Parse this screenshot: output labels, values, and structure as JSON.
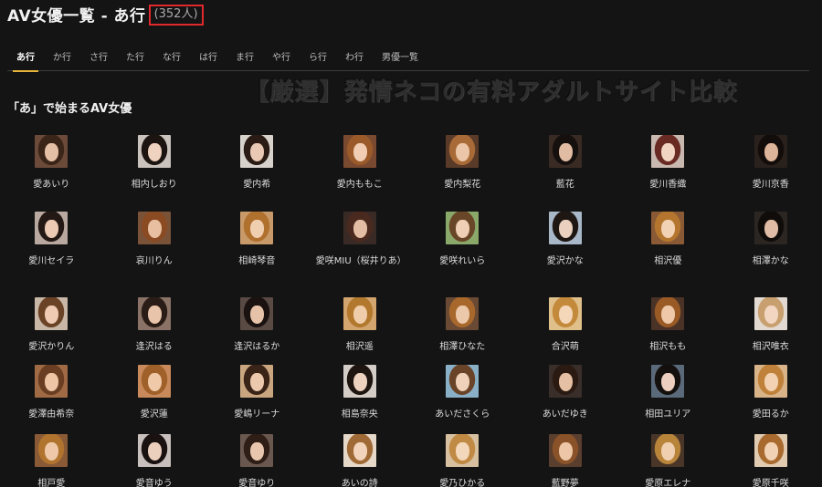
{
  "header": {
    "title": "AV女優一覧 - あ行",
    "count": "(352人)"
  },
  "tabs": [
    {
      "label": "あ行",
      "active": true
    },
    {
      "label": "か行",
      "active": false
    },
    {
      "label": "さ行",
      "active": false
    },
    {
      "label": "た行",
      "active": false
    },
    {
      "label": "な行",
      "active": false
    },
    {
      "label": "は行",
      "active": false
    },
    {
      "label": "ま行",
      "active": false
    },
    {
      "label": "や行",
      "active": false
    },
    {
      "label": "ら行",
      "active": false
    },
    {
      "label": "わ行",
      "active": false
    },
    {
      "label": "男優一覧",
      "active": false
    }
  ],
  "watermark": "【厳選】発情ネコの有料アダルトサイト比較",
  "section_title": "「あ」で始まるAV女優",
  "actresses": [
    {
      "name": "愛あいり",
      "hair": "#3a2518",
      "bg": "#6b4a3a",
      "skin": "#e6c0a6"
    },
    {
      "name": "相内しおり",
      "hair": "#1c1410",
      "bg": "#c9c2bd",
      "skin": "#efd2c0"
    },
    {
      "name": "愛内希",
      "hair": "#2a1c14",
      "bg": "#d8d2cc",
      "skin": "#e9c8b4"
    },
    {
      "name": "愛内ももこ",
      "hair": "#9a5a2a",
      "bg": "#7a4a30",
      "skin": "#f0cdb3"
    },
    {
      "name": "愛内梨花",
      "hair": "#a86a36",
      "bg": "#5a3a28",
      "skin": "#ecc6a8"
    },
    {
      "name": "藍花",
      "hair": "#15100e",
      "bg": "#3a2a24",
      "skin": "#e2bca2"
    },
    {
      "name": "愛川香織",
      "hair": "#6a2a24",
      "bg": "#c8b8b0",
      "skin": "#f2d4c2"
    },
    {
      "name": "愛川京香",
      "hair": "#120c0a",
      "bg": "#2a201c",
      "skin": "#dcb49a"
    },
    {
      "name": "愛川セイラ",
      "hair": "#241814",
      "bg": "#b8a8a0",
      "skin": "#eccab4"
    },
    {
      "name": "哀川りん",
      "hair": "#8a4a22",
      "bg": "#7a5238",
      "skin": "#e8bfa0"
    },
    {
      "name": "相崎琴音",
      "hair": "#b0702e",
      "bg": "#c89a6a",
      "skin": "#f0cfb0"
    },
    {
      "name": "愛咲MIU（桜井りあ）",
      "hair": "#4a2a1e",
      "bg": "#3a2a26",
      "skin": "#e4bea4"
    },
    {
      "name": "愛咲れいら",
      "hair": "#6a4628",
      "bg": "#8aa86a",
      "skin": "#efd0b6"
    },
    {
      "name": "愛沢かな",
      "hair": "#1e1612",
      "bg": "#a8b8c8",
      "skin": "#ead0be"
    },
    {
      "name": "相沢優",
      "hair": "#b4762e",
      "bg": "#8a5a36",
      "skin": "#f2d2b4"
    },
    {
      "name": "相澤かな",
      "hair": "#100c0a",
      "bg": "#2c2622",
      "skin": "#e0bca6"
    },
    {
      "name": "愛沢かりん",
      "hair": "#6a4226",
      "bg": "#c8b6a6",
      "skin": "#eecbb2"
    },
    {
      "name": "逢沢はる",
      "hair": "#2a1c16",
      "bg": "#8a7266",
      "skin": "#e8c4aa"
    },
    {
      "name": "逢沢はるか",
      "hair": "#1a1210",
      "bg": "#5a4a44",
      "skin": "#e6c2a8"
    },
    {
      "name": "相沢遥",
      "hair": "#b2782e",
      "bg": "#d2a46e",
      "skin": "#f0cdaa"
    },
    {
      "name": "相澤ひなた",
      "hair": "#a8682c",
      "bg": "#6a4a34",
      "skin": "#ecc8aa"
    },
    {
      "name": "合沢萌",
      "hair": "#c48a3c",
      "bg": "#e0c08a",
      "skin": "#f4d6b8"
    },
    {
      "name": "相沢もも",
      "hair": "#9a5a26",
      "bg": "#4a3226",
      "skin": "#eec8a8"
    },
    {
      "name": "相沢唯衣",
      "hair": "#c8a070",
      "bg": "#e2dad2",
      "skin": "#f2d6c2"
    },
    {
      "name": "愛澤由希奈",
      "hair": "#6a3e22",
      "bg": "#a06a44",
      "skin": "#eec6a6"
    },
    {
      "name": "愛沢蓮",
      "hair": "#a0602a",
      "bg": "#c88a5a",
      "skin": "#f0caa8"
    },
    {
      "name": "愛嶋リーナ",
      "hair": "#3a2418",
      "bg": "#caa680",
      "skin": "#ecc8ac"
    },
    {
      "name": "相島奈央",
      "hair": "#1e1410",
      "bg": "#d4ccc6",
      "skin": "#eed2c0"
    },
    {
      "name": "あいださくら",
      "hair": "#6a4428",
      "bg": "#8ab0c8",
      "skin": "#f0d2ba"
    },
    {
      "name": "あいだゆき",
      "hair": "#2a1a12",
      "bg": "#3a2e2a",
      "skin": "#e6c0a4"
    },
    {
      "name": "相田ユリア",
      "hair": "#14100e",
      "bg": "#5a6a7a",
      "skin": "#eccfbe"
    },
    {
      "name": "愛田るか",
      "hair": "#c0823a",
      "bg": "#d8b488",
      "skin": "#f2d2b2"
    },
    {
      "name": "相戸愛",
      "hair": "#b0742e",
      "bg": "#8a5a36",
      "skin": "#eec8a8"
    },
    {
      "name": "愛音ゆう",
      "hair": "#1a1210",
      "bg": "#c8c0bc",
      "skin": "#ecd0be"
    },
    {
      "name": "愛音ゆり",
      "hair": "#2e1e16",
      "bg": "#6a584e",
      "skin": "#e8c6ae"
    },
    {
      "name": "あいの詩",
      "hair": "#a06a36",
      "bg": "#e6d8c8",
      "skin": "#f2d4bc"
    },
    {
      "name": "愛乃ひかる",
      "hair": "#c08a44",
      "bg": "#d6c0a0",
      "skin": "#f4d8bc"
    },
    {
      "name": "藍野夢",
      "hair": "#8a5228",
      "bg": "#5a3e2e",
      "skin": "#ecc6a6"
    },
    {
      "name": "愛原エレナ",
      "hair": "#b8843a",
      "bg": "#4a3628",
      "skin": "#f0ceb0"
    },
    {
      "name": "愛原千咲",
      "hair": "#a86a2e",
      "bg": "#e0cab0",
      "skin": "#f2d2b4"
    }
  ]
}
